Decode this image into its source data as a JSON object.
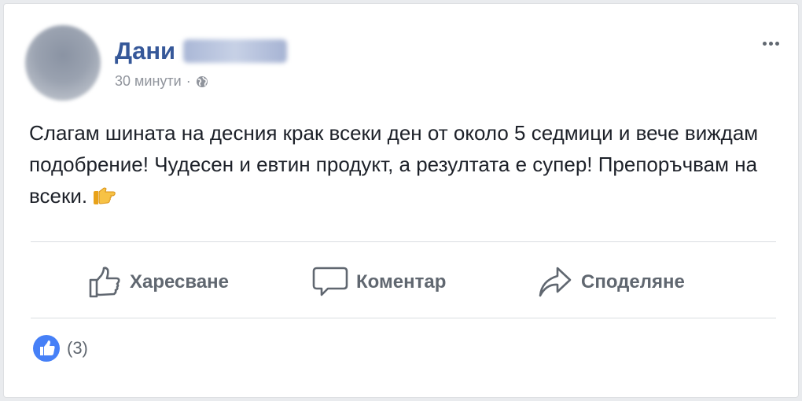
{
  "post": {
    "author_first_name": "Дани",
    "timestamp": "30 минути",
    "separator": "·",
    "text": "Слагам шината на десния крак всеки ден от около 5 седмици и вече виждам подобрение! Чудесен и евтин продукт, а резултата е супер! Препоръчвам на всеки.",
    "visibility_icon": "globe-icon",
    "emoji": "thumb-pointing-right"
  },
  "actions": {
    "like_label": "Харесване",
    "comment_label": "Коментар",
    "share_label": "Споделяне"
  },
  "reactions": {
    "count_label": "(3)",
    "icon": "like-icon",
    "color": "#4680f7"
  },
  "colors": {
    "author": "#365899",
    "action_text": "#606770"
  }
}
